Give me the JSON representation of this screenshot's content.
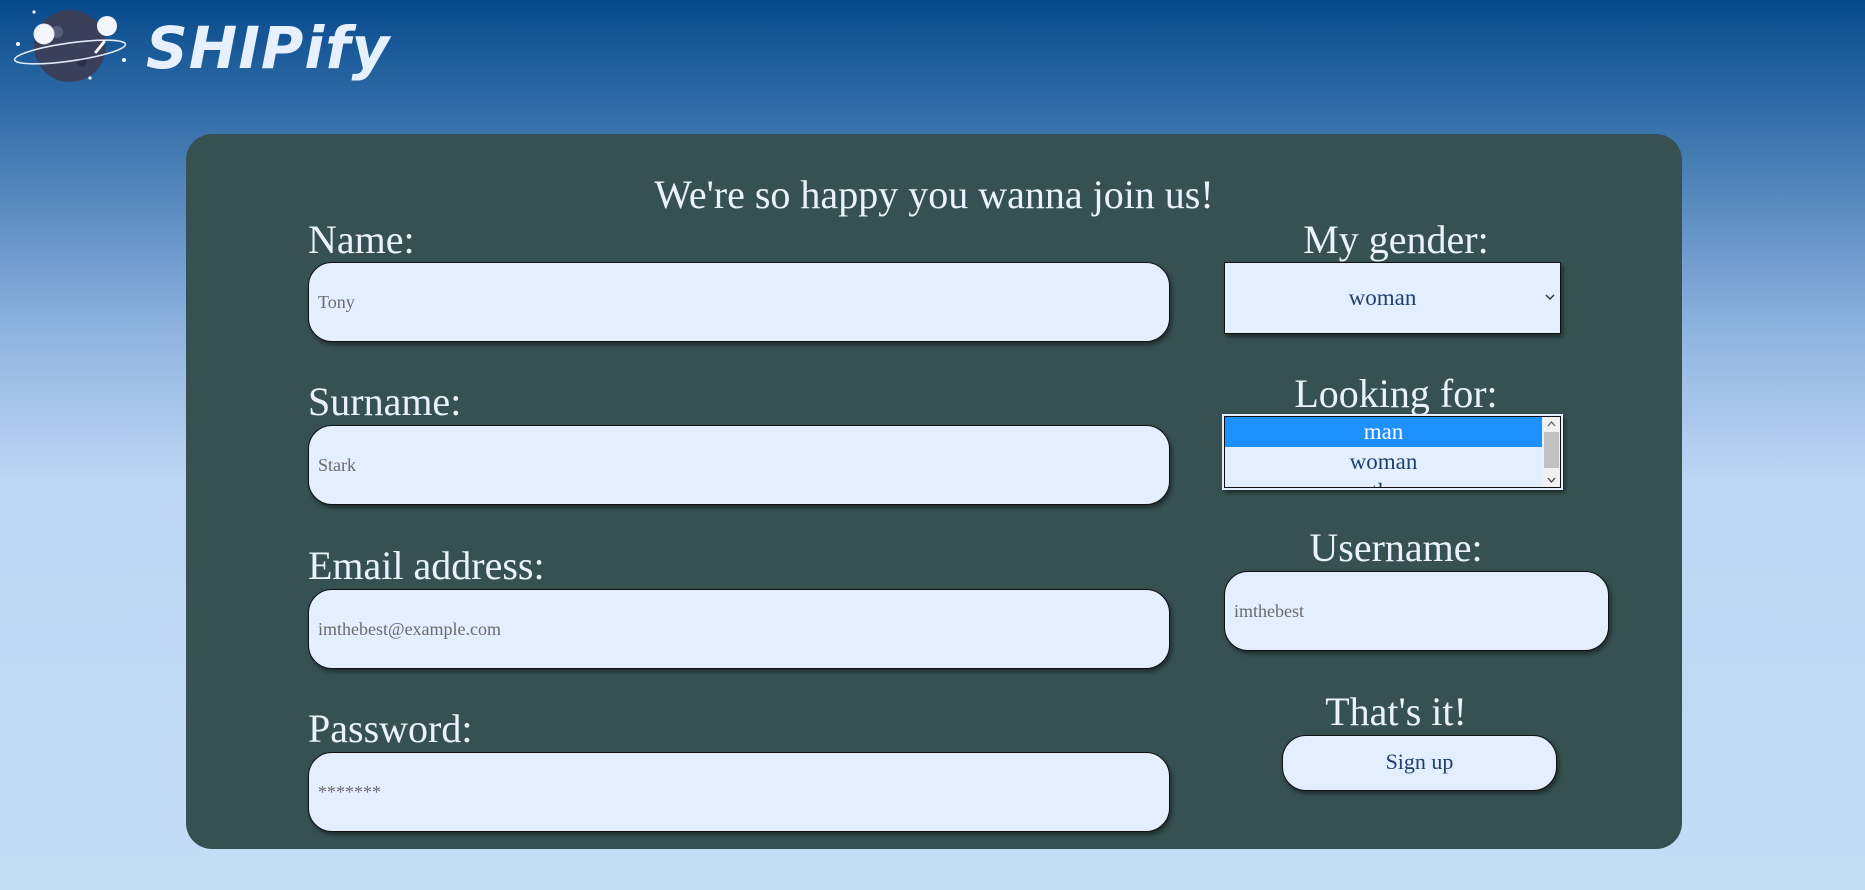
{
  "app": {
    "logo_text": "SHIPify",
    "logo_icon": "planet-icon"
  },
  "form": {
    "title": "We're so happy you wanna join us!",
    "name": {
      "label": "Name:",
      "placeholder": "Tony"
    },
    "surname": {
      "label": "Surname:",
      "placeholder": "Stark"
    },
    "email": {
      "label": "Email address:",
      "placeholder": "imthebest@example.com"
    },
    "password": {
      "label": "Password:",
      "placeholder": "*******"
    },
    "gender": {
      "label": "My gender:",
      "selected": "woman"
    },
    "looking_for": {
      "label": "Looking for:",
      "options": [
        "man",
        "woman",
        "other"
      ],
      "selected": "man"
    },
    "username": {
      "label": "Username:",
      "placeholder": "imthebest"
    },
    "submit": {
      "heading": "That's it!",
      "button_label": "Sign up"
    }
  },
  "colors": {
    "card_background": "#375152",
    "input_background": "#e3efff",
    "selected_option": "#1e90ff",
    "text_light": "#eaf2ff",
    "text_dark": "#1f3f6e"
  }
}
